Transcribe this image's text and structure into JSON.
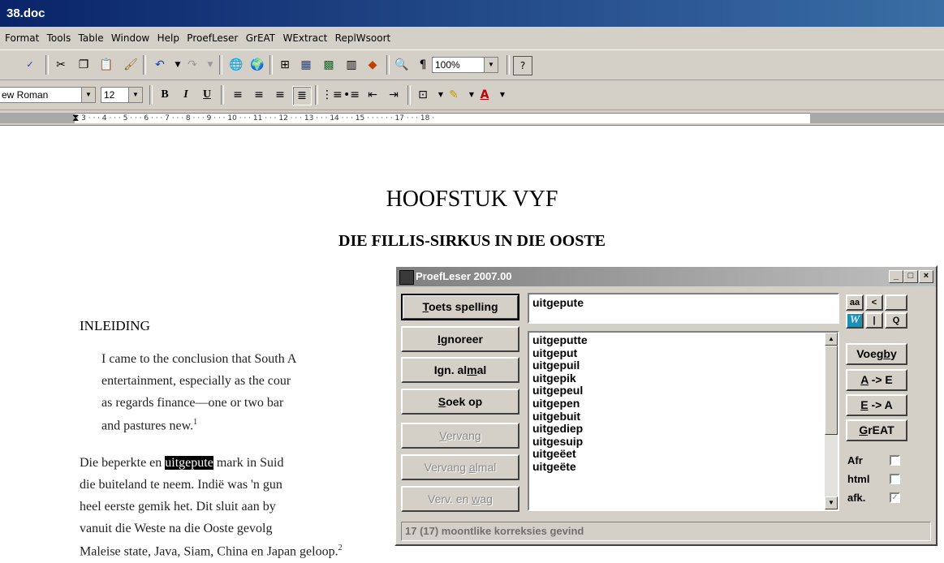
{
  "window": {
    "title": "38.doc"
  },
  "menu": [
    "Format",
    "Tools",
    "Table",
    "Window",
    "Help",
    "ProefLeser",
    "GrEAT",
    "WExtract",
    "ReplWsoort"
  ],
  "toolbar": {
    "zoom": "100%",
    "font_name": "ew Roman",
    "font_size": "12"
  },
  "ruler": {
    "marks": "· 1 · · ·   · · · 1 · · · 2 · · · 3 · · · 4 · · · 5 · · · 6 · · · 7 · · · 8 · · · 9 · · · 10 · · · 11 · · · 12 · · · 13 · · · 14 · · · 15 · · ·   · · · 17 · · · 18 ·"
  },
  "document": {
    "heading1": "HOOFSTUK VYF",
    "heading2": "DIE FILLIS-SIRKUS IN DIE OOSTE",
    "section": "INLEIDING",
    "quote_lines": [
      "I came to the conclusion that South A",
      "entertainment, especially as the cour",
      "as regards finance—one or two bar",
      "and pastures new."
    ],
    "quote_footnote": "1",
    "body_lines": [
      {
        "pre": "Die beperkte en ",
        "hl": "uitgepute",
        "post": " mark in Suid"
      },
      {
        "pre": "die buiteland te neem. Indië was 'n gun",
        "hl": "",
        "post": ""
      },
      {
        "pre": "heel eerste gemik het. Dit sluit aan by",
        "hl": "",
        "post": ""
      },
      {
        "pre": "vanuit die Weste na die Ooste gevolg",
        "hl": "",
        "post": ""
      },
      {
        "pre": "Maleise state, Java, Siam, China en Japan geloop.",
        "hl": "",
        "post": ""
      }
    ],
    "body_footnote": "2"
  },
  "dialog": {
    "title": "ProefLeser 2007.00",
    "word": "uitgepute",
    "buttons": {
      "toets": {
        "pre": "",
        "key": "T",
        "post": "oets spelling"
      },
      "ignoreer": {
        "pre": "",
        "key": "I",
        "post": "gnoreer"
      },
      "ign_almal": {
        "pre": "Ign. al",
        "key": "m",
        "post": "al"
      },
      "soek": {
        "pre": "",
        "key": "S",
        "post": "oek op"
      },
      "vervang": {
        "pre": "",
        "key": "V",
        "post": "ervang"
      },
      "vervang_almal": {
        "pre": "Vervang ",
        "key": "a",
        "post": "lmal"
      },
      "verv_wag": {
        "pre": "Verv. en ",
        "key": "w",
        "post": "ag"
      },
      "voegby": {
        "pre": "Voeg",
        "key": "b",
        "post": "y"
      },
      "a_e": {
        "pre": "",
        "key": "A",
        "post": " -> E"
      },
      "e_a": {
        "pre": "",
        "key": "E",
        "post": " -> A"
      },
      "great": {
        "pre": "",
        "key": "G",
        "post": "rEAT"
      },
      "aa": "aa",
      "lt": "<",
      "w": "W",
      "bar": "|",
      "q": "Q"
    },
    "suggestions": [
      "uitgeputte",
      "uitgeput",
      "uitgepuil",
      "uitgepik",
      "uitgepeul",
      "uitgepen",
      "uitgebuit",
      "uitgediep",
      "uitgesuip",
      "uitgeëet",
      "uitgeëte"
    ],
    "options": [
      {
        "label": "Afr",
        "checked": false
      },
      {
        "label": "html",
        "checked": false
      },
      {
        "label": "afk.",
        "checked": true
      }
    ],
    "status": "17 (17) moontlike korreksies gevind"
  }
}
